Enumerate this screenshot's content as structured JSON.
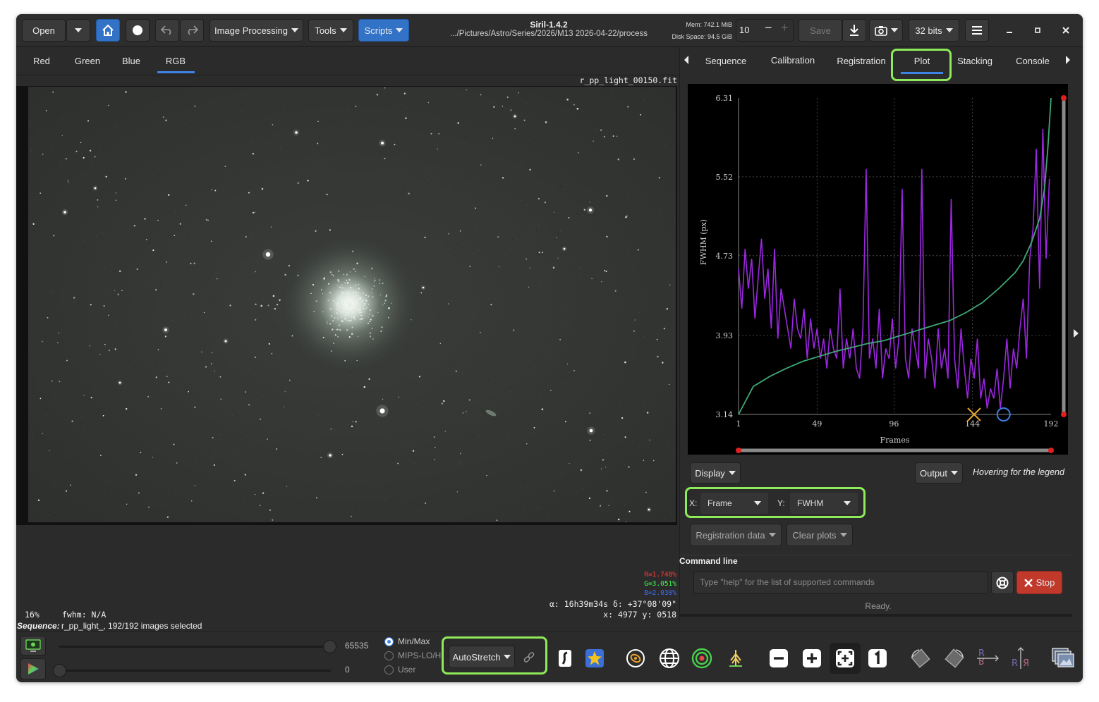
{
  "app": {
    "title": "Siril-1.4.2",
    "path": ".../Pictures/Astro/Series/2026/M13 2026-04-22/process",
    "mem": "Mem: 742.1 MiB",
    "disk": "Disk Space: 94.5 GiB"
  },
  "toolbar": {
    "open": "Open",
    "image_processing": "Image Processing",
    "tools": "Tools",
    "scripts": "Scripts",
    "thread_count": "10",
    "save": "Save",
    "bits": "32 bits"
  },
  "channels": [
    "Red",
    "Green",
    "Blue",
    "RGB"
  ],
  "image": {
    "filename": "r_pp_light_00150.fit",
    "zoom": "16%",
    "fwhm": "fwhm: N/A",
    "r": "R=1.748%",
    "g": "G=3.051%",
    "b": "B=2.030%",
    "radec": "α: 16h39m34s δ: +37°08'09\"",
    "xy": "x: 4977 y: 0518",
    "sequence_label": "Sequence:",
    "sequence_text": "r_pp_light_, 192/192 images selected"
  },
  "right_tabs": [
    "Sequence",
    "Calibration",
    "Registration",
    "Plot",
    "Stacking",
    "Console"
  ],
  "chart_data": {
    "type": "line",
    "xlabel": "Frames",
    "ylabel": "FWHM (px)",
    "xlim": [
      1,
      192
    ],
    "ylim": [
      3.14,
      6.31
    ],
    "xticks": [
      "1",
      "49",
      "96",
      "144",
      "192"
    ],
    "yticks": [
      "6.31",
      "5.52",
      "4.73",
      "3.93",
      "3.14"
    ],
    "grid": true,
    "series": [
      {
        "color": "#9c27e0",
        "x": [
          1,
          3,
          5,
          7,
          9,
          11,
          13,
          15,
          17,
          19,
          21,
          23,
          25,
          27,
          29,
          31,
          33,
          35,
          37,
          39,
          41,
          43,
          45,
          47,
          49,
          51,
          53,
          55,
          57,
          59,
          61,
          63,
          65,
          67,
          69,
          71,
          73,
          75,
          77,
          79,
          81,
          83,
          85,
          87,
          89,
          91,
          93,
          95,
          97,
          99,
          101,
          103,
          105,
          107,
          109,
          111,
          113,
          115,
          117,
          119,
          121,
          123,
          125,
          127,
          129,
          131,
          133,
          135,
          137,
          139,
          141,
          143,
          145,
          147,
          149,
          151,
          153,
          155,
          157,
          159,
          161,
          163,
          165,
          167,
          169,
          171,
          173,
          175,
          177,
          179,
          181,
          183,
          185,
          187,
          189,
          191
        ],
        "values": [
          4.6,
          4.2,
          4.8,
          4.4,
          4.7,
          4.1,
          4.5,
          4.9,
          4.3,
          4.6,
          4.0,
          4.8,
          3.9,
          4.4,
          4.2,
          4.0,
          3.8,
          4.3,
          4.0,
          3.9,
          4.2,
          3.7,
          4.1,
          3.8,
          4.0,
          3.7,
          3.9,
          3.6,
          4.0,
          3.8,
          3.7,
          4.4,
          3.6,
          3.9,
          3.7,
          4.0,
          3.6,
          3.5,
          4.0,
          5.6,
          3.7,
          3.9,
          3.6,
          4.2,
          3.5,
          3.8,
          3.7,
          4.1,
          3.6,
          3.9,
          5.4,
          3.7,
          3.5,
          4.0,
          3.8,
          3.6,
          5.6,
          3.5,
          3.9,
          3.7,
          3.4,
          4.0,
          3.6,
          3.8,
          3.5,
          5.3,
          3.7,
          3.4,
          4.0,
          3.6,
          3.3,
          3.7,
          3.5,
          3.9,
          3.3,
          3.5,
          3.2,
          3.4,
          3.3,
          3.6,
          3.2,
          3.5,
          3.9,
          3.4,
          3.8,
          3.6,
          4.0,
          4.3,
          3.7,
          4.7,
          5.0,
          5.8,
          4.4,
          6.0,
          4.7,
          5.5
        ]
      },
      {
        "color": "#3fa876",
        "x": [
          1,
          10,
          20,
          30,
          40,
          50,
          60,
          70,
          80,
          90,
          100,
          110,
          120,
          130,
          140,
          150,
          160,
          170,
          175,
          180,
          185,
          188,
          190,
          192
        ],
        "values": [
          3.14,
          3.42,
          3.52,
          3.6,
          3.67,
          3.72,
          3.77,
          3.81,
          3.85,
          3.88,
          3.93,
          3.98,
          4.03,
          4.08,
          4.16,
          4.26,
          4.4,
          4.56,
          4.68,
          4.86,
          5.1,
          5.4,
          5.8,
          6.31
        ]
      }
    ]
  },
  "plot_controls": {
    "display": "Display",
    "output": "Output",
    "legend_hint": "Hovering for the legend",
    "x_label": "X:",
    "x_value": "Frame",
    "y_label": "Y:",
    "y_value": "FWHM",
    "reg_data": "Registration data",
    "clear_plots": "Clear plots"
  },
  "command": {
    "label": "Command line",
    "placeholder": "Type \"help\" for the list of supported commands",
    "stop": "Stop",
    "status": "Ready."
  },
  "bottom": {
    "max_value": "65535",
    "min_value": "0",
    "radio_minmax": "Min/Max",
    "radio_mips": "MIPS-LO/HI",
    "radio_user": "User",
    "autostretch": "AutoStretch",
    "rgb_text_r": "R",
    "rgb_text_b": "B"
  },
  "icons": [
    "monitor-icon",
    "color-triangle-icon",
    "home-icon",
    "record-icon",
    "undo-icon",
    "redo-icon",
    "download-icon",
    "camera-icon",
    "hamburger-menu-icon",
    "minimize-icon",
    "maximize-icon",
    "close-icon",
    "link-icon",
    "galaxy-icon",
    "star-icon",
    "globe-icon",
    "target-icon",
    "tree-icon",
    "zoom-out-icon",
    "zoom-in-icon",
    "zoom-fit-icon",
    "zoom-one-icon",
    "rotate-left-icon",
    "rotate-right-icon",
    "mirror-x-icon",
    "mirror-y-icon",
    "image-stack-icon"
  ],
  "colors": {
    "accent": "#3273c8",
    "highlight": "#8fea5a",
    "fwhm_series": "#9c27e0",
    "sorted_series": "#3fa876",
    "stop": "#c0392b"
  }
}
